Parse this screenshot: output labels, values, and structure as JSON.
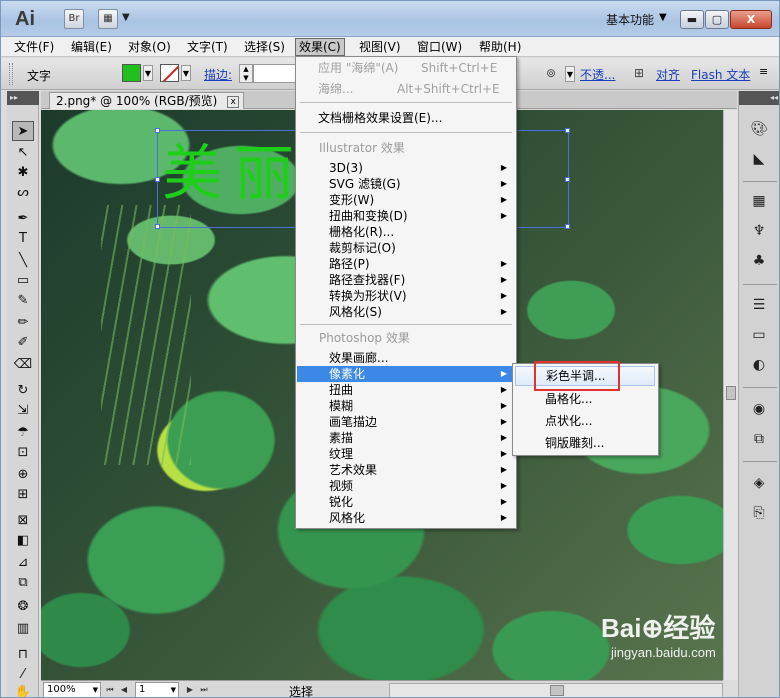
{
  "titlebar": {
    "app_logo": "Ai",
    "br_label": "Br",
    "layout_icon": "layout-grid-icon",
    "workspace": "基本功能",
    "min_label": "▭",
    "max_label": "□",
    "close_label": "X"
  },
  "menubar": {
    "items": [
      "文件(F)",
      "编辑(E)",
      "对象(O)",
      "文字(T)",
      "选择(S)",
      "效果(C)",
      "视图(V)",
      "窗口(W)",
      "帮助(H)"
    ],
    "active": "效果(C)"
  },
  "controlbar": {
    "label": "文字",
    "fill_color": "#22c01e",
    "stroke_label": "描边:",
    "opacity_label": "不透...",
    "align_label": "对齐",
    "flash_label": "Flash 文本"
  },
  "document": {
    "tab_title": "2.png* @ 100% (RGB/预览)",
    "close_label": "x",
    "headline_text": "美丽池塘"
  },
  "effect_menu": {
    "apply_last": "应用 \"海绵\"(A)",
    "apply_last_shortcut": "Shift+Ctrl+E",
    "last_effect": "海绵...",
    "last_effect_shortcut": "Alt+Shift+Ctrl+E",
    "raster_settings": "文档栅格效果设置(E)...",
    "illustrator_header": "Illustrator 效果",
    "illustrator_items": [
      "3D(3)",
      "SVG 滤镜(G)",
      "变形(W)",
      "扭曲和变换(D)",
      "栅格化(R)...",
      "裁剪标记(O)",
      "路径(P)",
      "路径查找器(F)",
      "转换为形状(V)",
      "风格化(S)"
    ],
    "photoshop_header": "Photoshop 效果",
    "photoshop_items": [
      "效果画廊...",
      "像素化",
      "扭曲",
      "模糊",
      "画笔描边",
      "素描",
      "纹理",
      "艺术效果",
      "视频",
      "锐化",
      "风格化"
    ],
    "highlighted": "像素化"
  },
  "pixelate_submenu": {
    "items": [
      "彩色半调...",
      "晶格化...",
      "点状化...",
      "铜版雕刻..."
    ],
    "highlighted": "彩色半调..."
  },
  "statusbar": {
    "zoom": "100%",
    "page": "1",
    "status": "选择"
  },
  "watermark": {
    "logo": "Bai⊕经验",
    "url": "jingyan.baidu.com"
  }
}
